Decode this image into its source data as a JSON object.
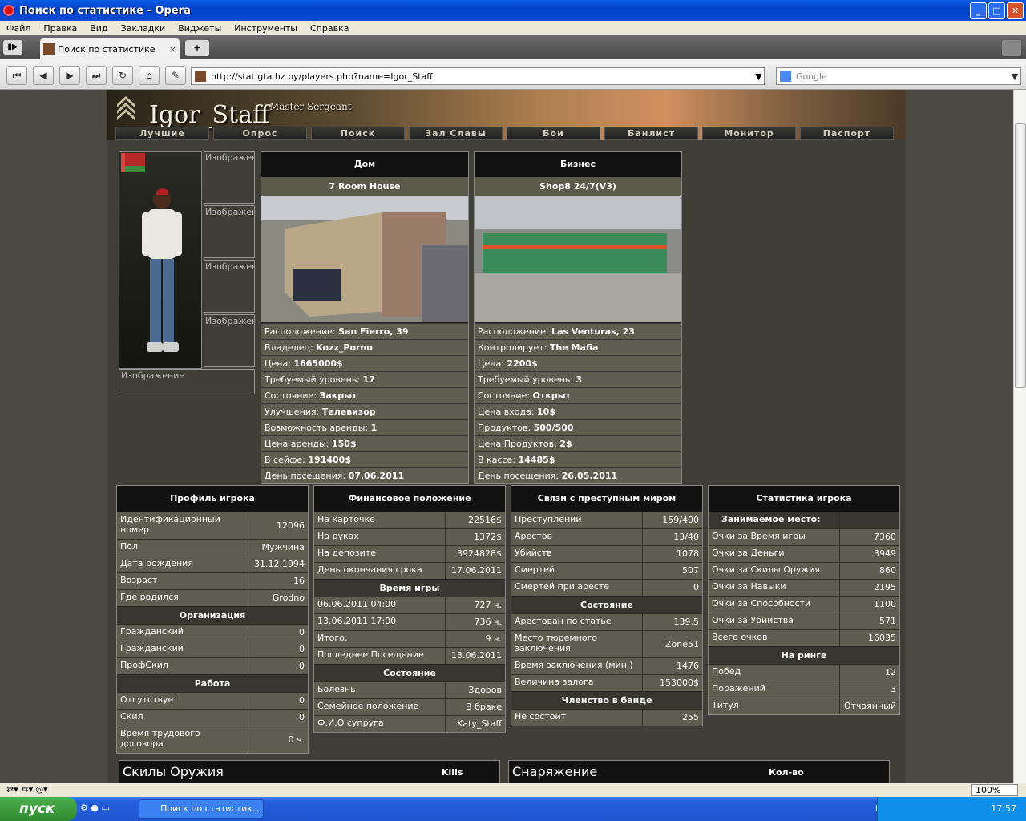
{
  "window": {
    "title": "Поиск по статистике - Opera"
  },
  "menu": [
    "Файл",
    "Правка",
    "Вид",
    "Закладки",
    "Виджеты",
    "Инструменты",
    "Справка"
  ],
  "tab": {
    "label": "Поиск по статистике",
    "close": "×",
    "new": "+"
  },
  "address": {
    "url": "http://stat.gta.hz.by/players.php?name=Igor_Staff",
    "search_placeholder": "Google"
  },
  "banner": {
    "name": "Igor_Staff",
    "rank": "Master Sergeant"
  },
  "nav": [
    "Лучшие",
    "Опрос",
    "Поиск",
    "Зал Славы",
    "Бои",
    "Банлист",
    "Монитор",
    "Паспорт"
  ],
  "images": {
    "label": "Изображен",
    "wide_label": "Изображение"
  },
  "house": {
    "header": "Дом",
    "name": "7 Room House",
    "rows": [
      {
        "k": "Расположение:",
        "v": "San Fierro, 39"
      },
      {
        "k": "Владелец:",
        "v": "Kozz_Porno"
      },
      {
        "k": "Цена:",
        "v": "1665000$"
      },
      {
        "k": "Требуемый уровень:",
        "v": "17"
      },
      {
        "k": "Состояние:",
        "v": "Закрыт"
      },
      {
        "k": "Улучшения:",
        "v": " Телевизор"
      },
      {
        "k": "Возможность аренды:",
        "v": "1"
      },
      {
        "k": "Цена аренды:",
        "v": "150$"
      },
      {
        "k": "В сейфе:",
        "v": "191400$"
      },
      {
        "k": "День посещения:",
        "v": "07.06.2011"
      }
    ]
  },
  "business": {
    "header": "Бизнес",
    "name": "Shop8 24/7(V3)",
    "rows": [
      {
        "k": "Расположение:",
        "v": "Las Venturas, 23"
      },
      {
        "k": "Контролирует:",
        "v": "The Mafia"
      },
      {
        "k": "Цена:",
        "v": "2200$"
      },
      {
        "k": "Требуемый уровень:",
        "v": "3"
      },
      {
        "k": "Состояние:",
        "v": "Открыт"
      },
      {
        "k": "Цена входа:",
        "v": "10$"
      },
      {
        "k": "Продуктов:",
        "v": "500/500"
      },
      {
        "k": "Цена Продуктов:",
        "v": "2$"
      },
      {
        "k": "В кассе:",
        "v": "14485$"
      },
      {
        "k": "День посещения:",
        "v": "26.05.2011"
      }
    ]
  },
  "profile": {
    "header": "Профиль игрока",
    "rows": [
      {
        "k": "Идентификационный номер",
        "v": "12096",
        "tall": true
      },
      {
        "k": "Пол",
        "v": "Мужчина"
      },
      {
        "k": "Дата рождения",
        "v": "31.12.1994"
      },
      {
        "k": "Возраст",
        "v": "16"
      },
      {
        "k": "Где родился",
        "v": "Grodno"
      }
    ],
    "org_title": "Организация",
    "org": [
      {
        "k": "Гражданский",
        "v": "0"
      },
      {
        "k": "Гражданский",
        "v": "0"
      },
      {
        "k": "ПрофСкил",
        "v": "0"
      }
    ],
    "work_title": "Работа",
    "work": [
      {
        "k": "Отсутствует",
        "v": "0"
      },
      {
        "k": "Скил",
        "v": "0"
      },
      {
        "k": "Время трудового договора",
        "v": "0 ч.",
        "tall": true
      }
    ]
  },
  "finance": {
    "header": "Финансовое положение",
    "rows": [
      {
        "k": "На карточке",
        "v": "22516$"
      },
      {
        "k": "На руках",
        "v": "1372$"
      },
      {
        "k": "На депозите",
        "v": "3924828$"
      },
      {
        "k": "День окончания срока",
        "v": "17.06.2011"
      }
    ],
    "time_title": "Время игры",
    "time": [
      {
        "k": "06.06.2011 04:00",
        "v": "727 ч."
      },
      {
        "k": "13.06.2011 17:00",
        "v": "736 ч."
      },
      {
        "k": "Итого:",
        "v": "9 ч."
      },
      {
        "k": "Последнее Посещение",
        "v": "13.06.2011"
      }
    ],
    "state_title": "Состояние",
    "state": [
      {
        "k": "Болезнь",
        "v": "Здоров"
      },
      {
        "k": "Семейное положение",
        "v": "В браке"
      },
      {
        "k": "Ф.И.О супруга",
        "v": "Katy_Staff"
      }
    ]
  },
  "crime": {
    "header": "Связи с преступным миром",
    "rows": [
      {
        "k": "Преступлений",
        "v": "159/400"
      },
      {
        "k": "Арестов",
        "v": "13/40"
      },
      {
        "k": "Убийств",
        "v": "1078"
      },
      {
        "k": "Смертей",
        "v": "507"
      },
      {
        "k": "Смертей при аресте",
        "v": "0"
      }
    ],
    "state_title": "Состояние",
    "state": [
      {
        "k": "Арестован по статье",
        "v": "139.5"
      },
      {
        "k": "Место тюремного заключения",
        "v": "Zone51",
        "tall": true
      },
      {
        "k": "Время заключения (мин.)",
        "v": "1476"
      },
      {
        "k": "Величина залога",
        "v": "153000$"
      }
    ],
    "gang_title": "Членство в банде",
    "gang": [
      {
        "k": "Не состоит",
        "v": "255"
      }
    ]
  },
  "stats": {
    "header": "Статистика игрока",
    "place_label": "Занимаемое место:",
    "place_value": "",
    "rows": [
      {
        "k": "Очки за Время игры",
        "v": "7360"
      },
      {
        "k": "Очки за Деньги",
        "v": "3949"
      },
      {
        "k": "Очки за Скилы Оружия",
        "v": "860"
      },
      {
        "k": "Очки за Навыки",
        "v": "2195"
      },
      {
        "k": "Очки за Способности",
        "v": "1100"
      },
      {
        "k": "Очки за Убийства",
        "v": "571"
      },
      {
        "k": "Всего очков",
        "v": "16035"
      }
    ],
    "ring_title": "На ринге",
    "ring": [
      {
        "k": "Побед",
        "v": "12"
      },
      {
        "k": "Поражений",
        "v": "3"
      },
      {
        "k": "Титул",
        "v": "Отчаянный"
      }
    ]
  },
  "bottom": {
    "weapons": "Скилы Оружия",
    "kills": "Kills",
    "gear": "Снаряжение",
    "count": "Кол-во"
  },
  "status": {
    "zoom": "100%"
  },
  "taskbar": {
    "start": "пуск",
    "task": "Поиск по статистик...",
    "lang": "EN",
    "time": "17:57"
  }
}
